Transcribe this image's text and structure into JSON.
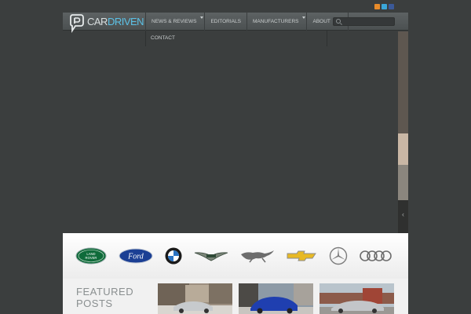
{
  "header": {
    "logo_text_1": "CAR",
    "logo_text_2": "DRIVEN"
  },
  "social": {
    "rss": "RSS",
    "twitter": "Twitter",
    "facebook": "Facebook"
  },
  "nav": {
    "items": [
      {
        "label": "NEWS & REVIEWS",
        "has_dropdown": true
      },
      {
        "label": "EDITORIALS",
        "has_dropdown": false
      },
      {
        "label": "MANUFACTURERS",
        "has_dropdown": true
      },
      {
        "label": "ABOUT",
        "has_dropdown": false
      },
      {
        "label": "CONTACT",
        "has_dropdown": false
      }
    ]
  },
  "search": {
    "placeholder": ""
  },
  "brands": [
    {
      "name": "land-rover",
      "text": "LAND ROVER"
    },
    {
      "name": "ford",
      "text": "Ford"
    },
    {
      "name": "bmw",
      "text": "BMW"
    },
    {
      "name": "aston-martin",
      "text": ""
    },
    {
      "name": "jaguar",
      "text": ""
    },
    {
      "name": "chevrolet",
      "text": ""
    },
    {
      "name": "mercedes",
      "text": ""
    },
    {
      "name": "audi",
      "text": ""
    }
  ],
  "featured": {
    "title_line1": "FEATURED",
    "title_line2": "POSTS"
  },
  "colors": {
    "background": "#3b3e3e",
    "accent": "#5bc1e6",
    "header": "#5d6263"
  }
}
